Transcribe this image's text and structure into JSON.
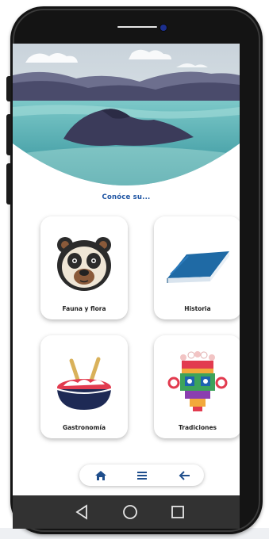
{
  "intro_text": "Conóce su...",
  "cards": [
    {
      "label": "Fauna y flora",
      "icon": "bear-icon"
    },
    {
      "label": "Historia",
      "icon": "book-icon"
    },
    {
      "label": "Gastronomía",
      "icon": "food-bowl-icon"
    },
    {
      "label": "Tradiciones",
      "icon": "mask-icon"
    }
  ],
  "bottom_nav": [
    {
      "icon": "home-icon"
    },
    {
      "icon": "menu-icon"
    },
    {
      "icon": "back-arrow-icon"
    }
  ],
  "system_nav": [
    {
      "icon": "triangle-back-icon"
    },
    {
      "icon": "circle-home-icon"
    },
    {
      "icon": "square-recents-icon"
    }
  ],
  "colors": {
    "accent": "#1f55a3",
    "lake": "#4fb3b3",
    "mountain": "#3b3b5a",
    "book": "#1f6aa5"
  }
}
